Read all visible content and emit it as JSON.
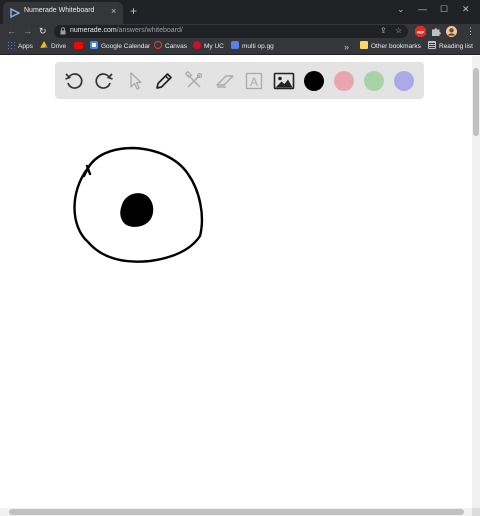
{
  "browser": {
    "tab_title": "Numerade Whiteboard",
    "tab_close": "×",
    "new_tab": "+",
    "window_controls": {
      "dropdown": "⌄",
      "minimize": "—",
      "maximize": "☐",
      "close": "✕"
    },
    "url_host": "numerade.com",
    "url_path": "/answers/whiteboard/",
    "extension_badge": "ABP",
    "bookmarks": [
      {
        "label": "Apps",
        "icon": "apps-grid-icon",
        "color": "#4285f4"
      },
      {
        "label": "Drive",
        "icon": "google-drive-icon",
        "color": "#fbbc04"
      },
      {
        "label": "",
        "icon": "youtube-icon",
        "color": "#ff0000"
      },
      {
        "label": "Google Calendar",
        "icon": "calendar-icon",
        "color": "#4285f4"
      },
      {
        "label": "Canvas",
        "icon": "canvas-icon",
        "color": "#e13f2b"
      },
      {
        "label": "My UC",
        "icon": "uc-icon",
        "color": "#c8102e"
      },
      {
        "label": "multi op.gg",
        "icon": "opgg-icon",
        "color": "#5383e8"
      }
    ],
    "bookmarks_more": "»",
    "other_bookmarks": "Other bookmarks",
    "reading_list": "Reading list"
  },
  "whiteboard": {
    "tools": [
      {
        "name": "undo-icon",
        "tooltip": "Undo"
      },
      {
        "name": "redo-icon",
        "tooltip": "Redo"
      },
      {
        "name": "select-cursor-icon",
        "tooltip": "Select"
      },
      {
        "name": "pen-icon",
        "tooltip": "Pen"
      },
      {
        "name": "tools-icon",
        "tooltip": "Tools"
      },
      {
        "name": "eraser-icon",
        "tooltip": "Eraser"
      },
      {
        "name": "text-icon",
        "tooltip": "Text",
        "glyph": "A"
      },
      {
        "name": "image-icon",
        "tooltip": "Image"
      }
    ],
    "colors": [
      "#000000",
      "#e8a6b0",
      "#a9d3a7",
      "#aaaae8"
    ],
    "selected_color": "#000000"
  }
}
